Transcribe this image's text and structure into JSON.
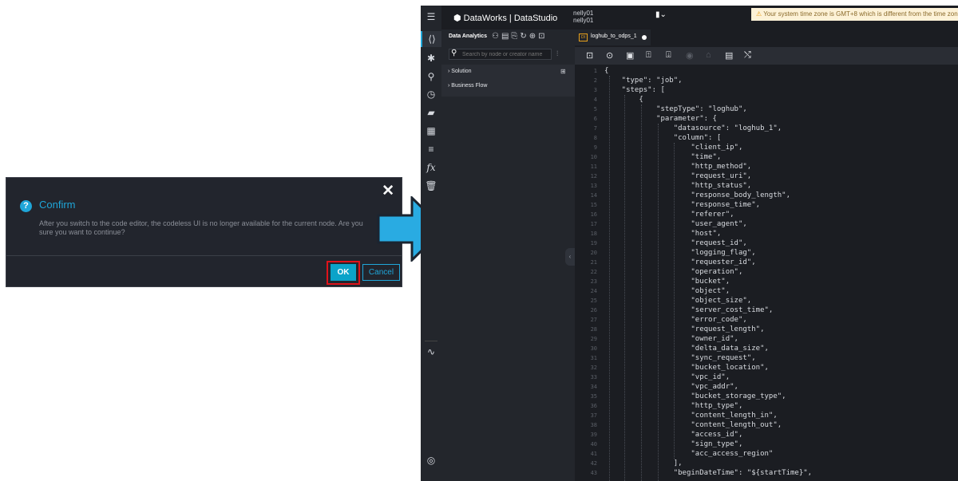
{
  "dialog": {
    "title": "Confirm",
    "message": "After you switch to the code editor, the codeless UI is no longer available for the current node. Are you sure you want to continue?",
    "ok_label": "OK",
    "cancel_label": "Cancel",
    "close_glyph": "✕",
    "info_glyph": "?"
  },
  "app": {
    "logo": "DataWorks | DataStudio",
    "user_line1": "nelly01",
    "user_line2": "nelly01",
    "warning": "Your system time zone is GMT+8 which is different from the time zone that se",
    "sidebar_header": "Data Analytics",
    "search_placeholder": "Search by node or creator name",
    "tree": [
      {
        "label": "Solution"
      },
      {
        "label": "Business Flow"
      }
    ],
    "tab_label": "loghub_to_odps_1",
    "tab_icon_text": "DI"
  },
  "icons": {
    "rail": [
      "menu-icon",
      "code-icon",
      "pin-icon",
      "search-icon",
      "clock-icon",
      "briefcase-icon",
      "table-icon",
      "list-icon",
      "function-icon",
      "trash-icon",
      "activity-icon",
      "settings-icon"
    ],
    "toolbar": [
      "save-icon",
      "run-icon",
      "run-params-icon",
      "submit-icon",
      "publish-icon",
      "stop-icon",
      "lock-icon",
      "format-icon",
      "convert-icon"
    ]
  },
  "colors": {
    "accent": "#1fa6d9",
    "ok_highlight": "#e0121a",
    "editor_bg": "#1b1d22"
  },
  "code": {
    "lines": [
      "{",
      "    \"type\": \"job\",",
      "    \"steps\": [",
      "        {",
      "            \"stepType\": \"loghub\",",
      "            \"parameter\": {",
      "                \"datasource\": \"loghub_1\",",
      "                \"column\": [",
      "                    \"client_ip\",",
      "                    \"time\",",
      "                    \"http_method\",",
      "                    \"request_uri\",",
      "                    \"http_status\",",
      "                    \"response_body_length\",",
      "                    \"response_time\",",
      "                    \"referer\",",
      "                    \"user_agent\",",
      "                    \"host\",",
      "                    \"request_id\",",
      "                    \"logging_flag\",",
      "                    \"requester_id\",",
      "                    \"operation\",",
      "                    \"bucket\",",
      "                    \"object\",",
      "                    \"object_size\",",
      "                    \"server_cost_time\",",
      "                    \"error_code\",",
      "                    \"request_length\",",
      "                    \"owner_id\",",
      "                    \"delta_data_size\",",
      "                    \"sync_request\",",
      "                    \"bucket_location\",",
      "                    \"vpc_id\",",
      "                    \"vpc_addr\",",
      "                    \"bucket_storage_type\",",
      "                    \"http_type\",",
      "                    \"content_length_in\",",
      "                    \"content_length_out\",",
      "                    \"access_id\",",
      "                    \"sign_type\",",
      "                    \"acc_access_region\"",
      "                ],",
      "                \"beginDateTime\": \"${startTime}\","
    ]
  }
}
